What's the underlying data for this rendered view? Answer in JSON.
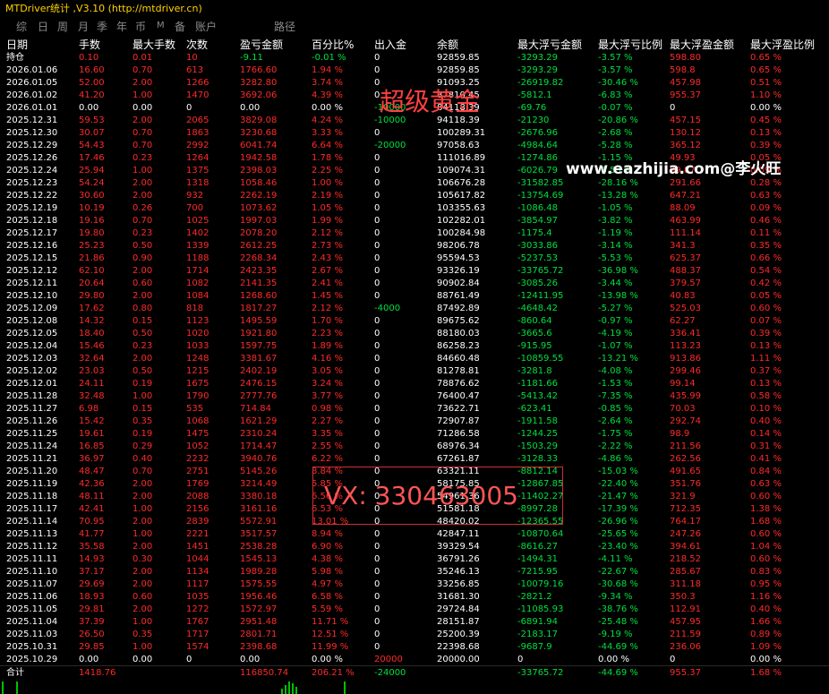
{
  "window": {
    "title": "MTDriver统计 ,V3.10 (http://mtdriver.cn)"
  },
  "tabs": [
    "综",
    "日",
    "周",
    "月",
    "季",
    "年",
    "币",
    "M",
    "备",
    "账户",
    "路径"
  ],
  "columns": [
    "日期",
    "手数",
    "最大手数",
    "次数",
    "盈亏金额",
    "百分比%",
    "出入金",
    "余额",
    "最大浮亏金额",
    "最大浮亏比例",
    "最大浮盈金额",
    "最大浮盈比例"
  ],
  "holding": [
    "持仓",
    "0.10",
    "0.01",
    "10",
    "-9.11",
    "-0.01 %",
    "0",
    "92859.85",
    "-3293.29",
    "-3.57 %",
    "598.80",
    "0.65 %"
  ],
  "rows": [
    [
      "2026.01.06",
      "16.60",
      "0.70",
      "613",
      "1766.60",
      "1.94 %",
      "0",
      "92859.85",
      "-3293.29",
      "-3.57 %",
      "598.8",
      "0.65 %"
    ],
    [
      "2026.01.05",
      "52.00",
      "2.00",
      "1266",
      "3282.80",
      "3.74 %",
      "0",
      "91093.25",
      "-26919.82",
      "-30.46 %",
      "457.98",
      "0.51 %"
    ],
    [
      "2026.01.02",
      "41.20",
      "1.00",
      "1470",
      "3692.06",
      "4.39 %",
      "0",
      "87810.45",
      "-5812.1",
      "-6.83 %",
      "955.37",
      "1.10 %"
    ],
    [
      "2026.01.01",
      "0.00",
      "0.00",
      "0",
      "0.00",
      "0.00 %",
      "-10000",
      "84118.39",
      "-69.76",
      "-0.07 %",
      "0",
      "0.00 %"
    ],
    [
      "2025.12.31",
      "59.53",
      "2.00",
      "2065",
      "3829.08",
      "4.24 %",
      "-10000",
      "94118.39",
      "-21230",
      "-20.86 %",
      "457.15",
      "0.45 %"
    ],
    [
      "2025.12.30",
      "30.07",
      "0.70",
      "1863",
      "3230.68",
      "3.33 %",
      "0",
      "100289.31",
      "-2676.96",
      "-2.68 %",
      "130.12",
      "0.13 %"
    ],
    [
      "2025.12.29",
      "54.43",
      "0.70",
      "2992",
      "6041.74",
      "6.64 %",
      "-20000",
      "97058.63",
      "-4984.64",
      "-5.28 %",
      "365.12",
      "0.39 %"
    ],
    [
      "2025.12.26",
      "17.46",
      "0.23",
      "1264",
      "1942.58",
      "1.78 %",
      "0",
      "111016.89",
      "-1274.86",
      "-1.15 %",
      "49.93",
      "0.05 %"
    ],
    [
      "2025.12.24",
      "25.94",
      "1.00",
      "1375",
      "2398.03",
      "2.25 %",
      "0",
      "109074.31",
      "-6026.79",
      "-5.53 %",
      "99.87",
      "0.09 %"
    ],
    [
      "2025.12.23",
      "54.24",
      "2.00",
      "1318",
      "1058.46",
      "1.00 %",
      "0",
      "106676.28",
      "-31582.85",
      "-28.16 %",
      "291.66",
      "0.28 %"
    ],
    [
      "2025.12.22",
      "30.60",
      "2.00",
      "932",
      "2262.19",
      "2.19 %",
      "0",
      "105617.82",
      "-13754.69",
      "-13.28 %",
      "647.21",
      "0.63 %"
    ],
    [
      "2025.12.19",
      "10.19",
      "0.26",
      "700",
      "1073.62",
      "1.05 %",
      "0",
      "103355.63",
      "-1086.48",
      "-1.05 %",
      "88.09",
      "0.09 %"
    ],
    [
      "2025.12.18",
      "19.16",
      "0.70",
      "1025",
      "1997.03",
      "1.99 %",
      "0",
      "102282.01",
      "-3854.97",
      "-3.82 %",
      "463.99",
      "0.46 %"
    ],
    [
      "2025.12.17",
      "19.80",
      "0.23",
      "1402",
      "2078.20",
      "2.12 %",
      "0",
      "100284.98",
      "-1175.4",
      "-1.19 %",
      "111.14",
      "0.11 %"
    ],
    [
      "2025.12.16",
      "25.23",
      "0.50",
      "1339",
      "2612.25",
      "2.73 %",
      "0",
      "98206.78",
      "-3033.86",
      "-3.14 %",
      "341.3",
      "0.35 %"
    ],
    [
      "2025.12.15",
      "21.86",
      "0.90",
      "1188",
      "2268.34",
      "2.43 %",
      "0",
      "95594.53",
      "-5237.53",
      "-5.53 %",
      "625.37",
      "0.66 %"
    ],
    [
      "2025.12.12",
      "62.10",
      "2.00",
      "1714",
      "2423.35",
      "2.67 %",
      "0",
      "93326.19",
      "-33765.72",
      "-36.98 %",
      "488.37",
      "0.54 %"
    ],
    [
      "2025.12.11",
      "20.64",
      "0.60",
      "1082",
      "2141.35",
      "2.41 %",
      "0",
      "90902.84",
      "-3085.26",
      "-3.44 %",
      "379.57",
      "0.42 %"
    ],
    [
      "2025.12.10",
      "29.80",
      "2.00",
      "1084",
      "1268.60",
      "1.45 %",
      "0",
      "88761.49",
      "-12411.95",
      "-13.98 %",
      "40.83",
      "0.05 %"
    ],
    [
      "2025.12.09",
      "17.62",
      "0.80",
      "818",
      "1817.27",
      "2.12 %",
      "-4000",
      "87492.89",
      "-4648.42",
      "-5.27 %",
      "525.03",
      "0.60 %"
    ],
    [
      "2025.12.08",
      "14.32",
      "0.15",
      "1123",
      "1495.59",
      "1.70 %",
      "0",
      "89675.62",
      "-860.64",
      "-0.97 %",
      "62.27",
      "0.07 %"
    ],
    [
      "2025.12.05",
      "18.40",
      "0.50",
      "1020",
      "1921.80",
      "2.23 %",
      "0",
      "88180.03",
      "-3665.6",
      "-4.19 %",
      "336.41",
      "0.39 %"
    ],
    [
      "2025.12.04",
      "15.46",
      "0.23",
      "1033",
      "1597.75",
      "1.89 %",
      "0",
      "86258.23",
      "-915.95",
      "-1.07 %",
      "113.23",
      "0.13 %"
    ],
    [
      "2025.12.03",
      "32.64",
      "2.00",
      "1248",
      "3381.67",
      "4.16 %",
      "0",
      "84660.48",
      "-10859.55",
      "-13.21 %",
      "913.86",
      "1.11 %"
    ],
    [
      "2025.12.02",
      "23.03",
      "0.50",
      "1215",
      "2402.19",
      "3.05 %",
      "0",
      "81278.81",
      "-3281.8",
      "-4.08 %",
      "299.46",
      "0.37 %"
    ],
    [
      "2025.12.01",
      "24.11",
      "0.19",
      "1675",
      "2476.15",
      "3.24 %",
      "0",
      "78876.62",
      "-1181.66",
      "-1.53 %",
      "99.14",
      "0.13 %"
    ],
    [
      "2025.11.28",
      "32.48",
      "1.00",
      "1790",
      "2777.76",
      "3.77 %",
      "0",
      "76400.47",
      "-5413.42",
      "-7.35 %",
      "435.99",
      "0.58 %"
    ],
    [
      "2025.11.27",
      "6.98",
      "0.15",
      "535",
      "714.84",
      "0.98 %",
      "0",
      "73622.71",
      "-623.41",
      "-0.85 %",
      "70.03",
      "0.10 %"
    ],
    [
      "2025.11.26",
      "15.42",
      "0.35",
      "1068",
      "1621.29",
      "2.27 %",
      "0",
      "72907.87",
      "-1911.58",
      "-2.64 %",
      "292.74",
      "0.40 %"
    ],
    [
      "2025.11.25",
      "19.61",
      "0.19",
      "1475",
      "2310.24",
      "3.35 %",
      "0",
      "71286.58",
      "-1244.25",
      "-1.75 %",
      "98.9",
      "0.14 %"
    ],
    [
      "2025.11.24",
      "16.85",
      "0.29",
      "1052",
      "1714.47",
      "2.55 %",
      "0",
      "68976.34",
      "-1503.29",
      "-2.22 %",
      "211.56",
      "0.31 %"
    ],
    [
      "2025.11.21",
      "36.97",
      "0.40",
      "2232",
      "3940.76",
      "6.22 %",
      "0",
      "67261.87",
      "-3128.33",
      "-4.86 %",
      "262.56",
      "0.41 %"
    ],
    [
      "2025.11.20",
      "48.47",
      "0.70",
      "2751",
      "5145.26",
      "8.84 %",
      "0",
      "63321.11",
      "-8812.14",
      "-15.03 %",
      "491.65",
      "0.84 %"
    ],
    [
      "2025.11.19",
      "42.36",
      "2.00",
      "1769",
      "3214.49",
      "5.85 %",
      "0",
      "58175.85",
      "-12867.85",
      "-22.40 %",
      "351.76",
      "0.63 %"
    ],
    [
      "2025.11.18",
      "48.11",
      "2.00",
      "2088",
      "3380.18",
      "6.56 %",
      "0",
      "54961.36",
      "-11402.27",
      "-21.47 %",
      "321.9",
      "0.60 %"
    ],
    [
      "2025.11.17",
      "42.41",
      "1.00",
      "2156",
      "3161.16",
      "6.53 %",
      "0",
      "51581.18",
      "-8997.28",
      "-17.39 %",
      "712.35",
      "1.38 %"
    ],
    [
      "2025.11.14",
      "70.95",
      "2.00",
      "2839",
      "5572.91",
      "13.01 %",
      "0",
      "48420.02",
      "-12365.55",
      "-26.96 %",
      "764.17",
      "1.68 %"
    ],
    [
      "2025.11.13",
      "41.77",
      "1.00",
      "2221",
      "3517.57",
      "8.94 %",
      "0",
      "42847.11",
      "-10870.64",
      "-25.65 %",
      "247.26",
      "0.60 %"
    ],
    [
      "2025.11.12",
      "35.58",
      "2.00",
      "1451",
      "2538.28",
      "6.90 %",
      "0",
      "39329.54",
      "-8616.27",
      "-23.40 %",
      "394.61",
      "1.04 %"
    ],
    [
      "2025.11.11",
      "14.93",
      "0.30",
      "1044",
      "1545.13",
      "4.38 %",
      "0",
      "36791.26",
      "-1494.31",
      "-4.11 %",
      "218.52",
      "0.60 %"
    ],
    [
      "2025.11.10",
      "37.17",
      "2.00",
      "1134",
      "1989.28",
      "5.98 %",
      "0",
      "35246.13",
      "-7215.95",
      "-22.67 %",
      "285.67",
      "0.83 %"
    ],
    [
      "2025.11.07",
      "29.69",
      "2.00",
      "1117",
      "1575.55",
      "4.97 %",
      "0",
      "33256.85",
      "-10079.16",
      "-30.68 %",
      "311.18",
      "0.95 %"
    ],
    [
      "2025.11.06",
      "18.93",
      "0.60",
      "1035",
      "1956.46",
      "6.58 %",
      "0",
      "31681.30",
      "-2821.2",
      "-9.34 %",
      "350.3",
      "1.16 %"
    ],
    [
      "2025.11.05",
      "29.81",
      "2.00",
      "1272",
      "1572.97",
      "5.59 %",
      "0",
      "29724.84",
      "-11085.93",
      "-38.76 %",
      "112.91",
      "0.40 %"
    ],
    [
      "2025.11.04",
      "37.39",
      "1.00",
      "1767",
      "2951.48",
      "11.71 %",
      "0",
      "28151.87",
      "-6891.94",
      "-25.48 %",
      "457.95",
      "1.66 %"
    ],
    [
      "2025.11.03",
      "26.50",
      "0.35",
      "1717",
      "2801.71",
      "12.51 %",
      "0",
      "25200.39",
      "-2183.17",
      "-9.19 %",
      "211.59",
      "0.89 %"
    ],
    [
      "2025.10.31",
      "29.85",
      "1.00",
      "1574",
      "2398.68",
      "11.99 %",
      "0",
      "22398.68",
      "-9687.9",
      "-44.69 %",
      "236.06",
      "1.09 %"
    ],
    [
      "2025.10.29",
      "0.00",
      "0.00",
      "0",
      "0.00",
      "0.00 %",
      "20000",
      "20000.00",
      "0",
      "0.00 %",
      "0",
      "0.00 %"
    ]
  ],
  "total": [
    "合计",
    "1418.76",
    "",
    "",
    "116850.74",
    "206.21 %",
    "-24000",
    "",
    "-33765.72",
    "-44.69 %",
    "955.37",
    "1.68 %"
  ],
  "watermarks": {
    "top": "超级黄金",
    "site": "www.eazhijia.com@李火旺",
    "contact": "VX: 330463005"
  },
  "colors": {
    "positive": "#ff2a2a",
    "negative": "#00e040",
    "neutral": "#ffffff",
    "title": "#ffd200"
  }
}
